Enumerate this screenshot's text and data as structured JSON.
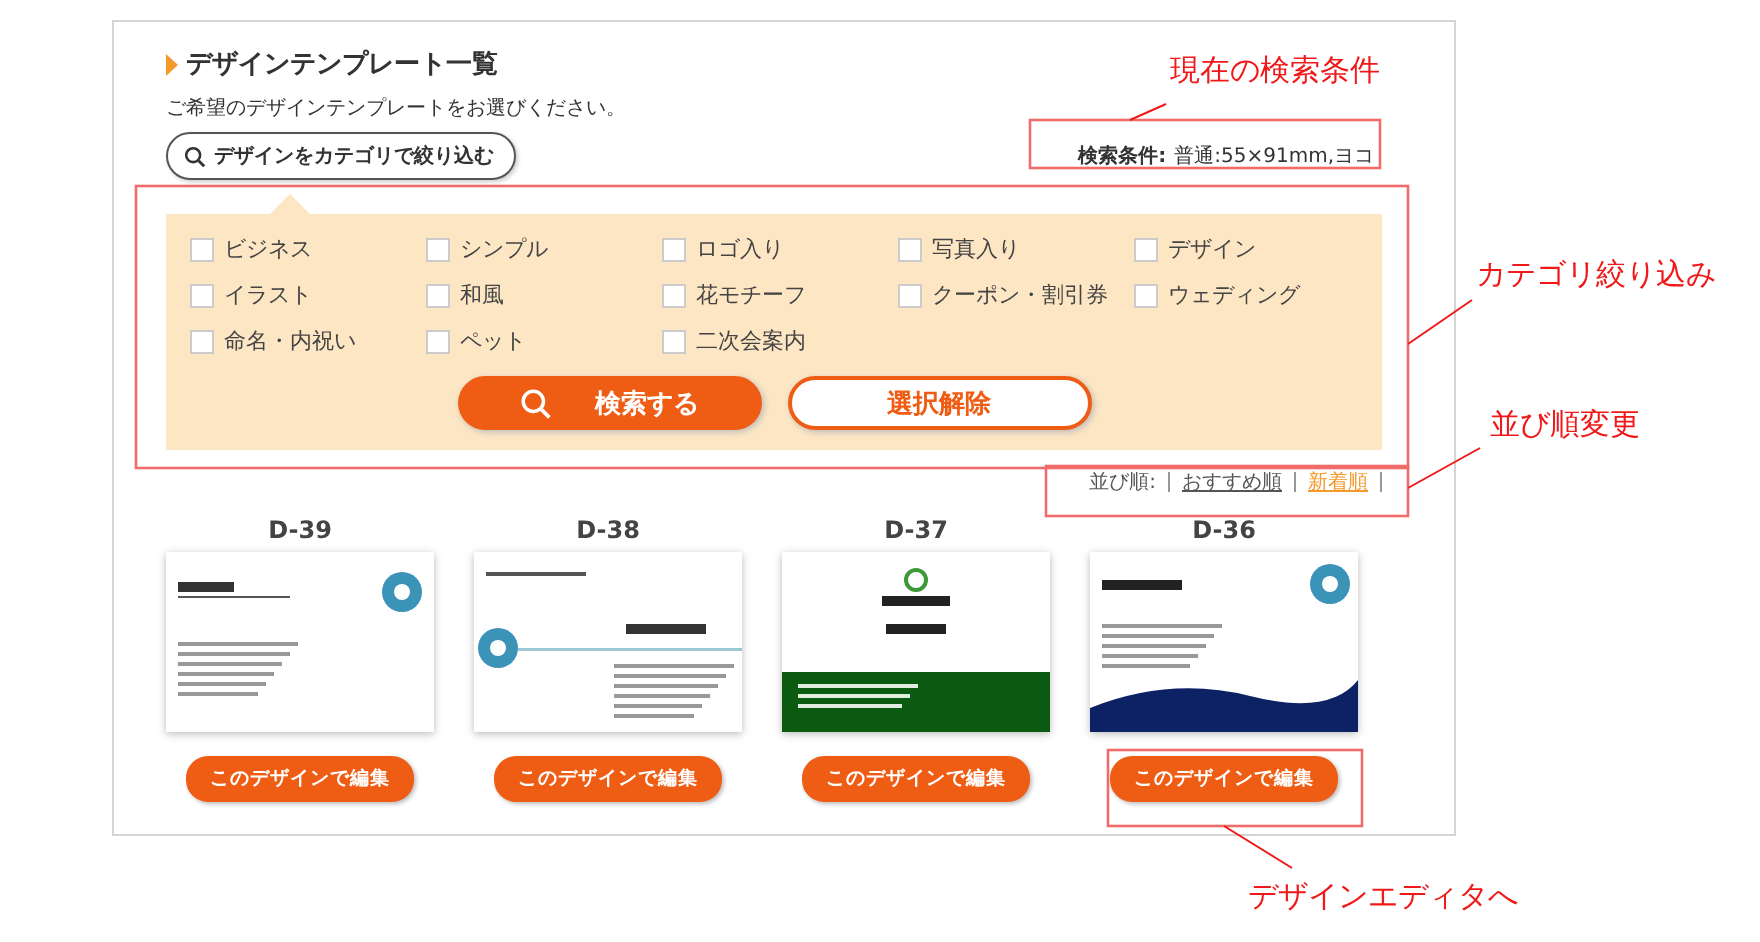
{
  "panel": {
    "title": "デザインテンプレート一覧",
    "subtitle": "ご希望のデザインテンプレートをお選びください。",
    "filter_button": "デザインをカテゴリで絞り込む",
    "condition": {
      "label": "検索条件:",
      "value": "普通:55×91mm,ヨコ"
    }
  },
  "categories": [
    {
      "label": "ビジネス",
      "checked": false
    },
    {
      "label": "シンプル",
      "checked": false
    },
    {
      "label": "ロゴ入り",
      "checked": false
    },
    {
      "label": "写真入り",
      "checked": false
    },
    {
      "label": "デザイン",
      "checked": false
    },
    {
      "label": "イラスト",
      "checked": false
    },
    {
      "label": "和風",
      "checked": false
    },
    {
      "label": "花モチーフ",
      "checked": false
    },
    {
      "label": "クーポン・割引券",
      "checked": false
    },
    {
      "label": "ウェディング",
      "checked": false
    },
    {
      "label": "命名・内祝い",
      "checked": false
    },
    {
      "label": "ペット",
      "checked": false
    },
    {
      "label": "二次会案内",
      "checked": false
    }
  ],
  "search_button": "検索する",
  "clear_button": "選択解除",
  "sort": {
    "label": "並び順:",
    "options": [
      {
        "label": "おすすめ順",
        "selected": false
      },
      {
        "label": "新着順",
        "selected": true
      }
    ]
  },
  "templates": [
    {
      "code": "D-39",
      "kind": "plain",
      "button": "このデザインで編集"
    },
    {
      "code": "D-38",
      "kind": "rule",
      "button": "このデザインで編集"
    },
    {
      "code": "D-37",
      "kind": "band",
      "button": "このデザインで編集"
    },
    {
      "code": "D-36",
      "kind": "wave",
      "button": "このデザインで編集"
    }
  ],
  "annotations": [
    "現在の検索条件",
    "カテゴリ絞り込み",
    "並び順変更",
    "デザインエディタへ"
  ]
}
